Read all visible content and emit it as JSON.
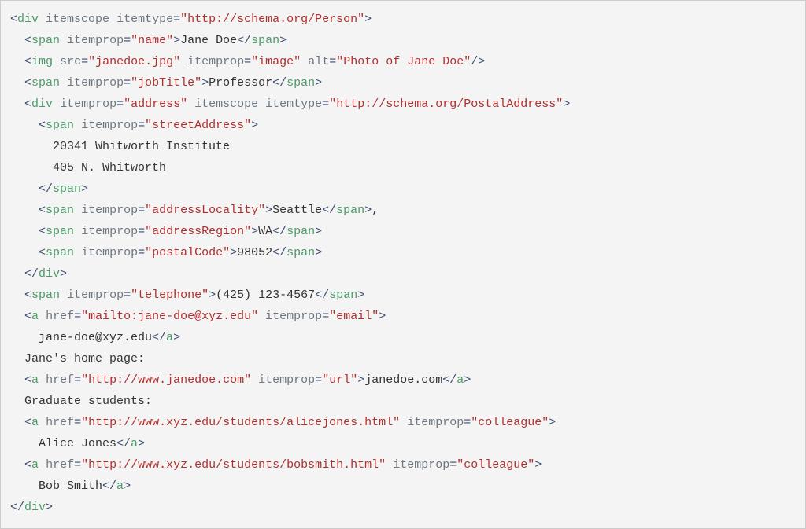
{
  "code": {
    "lines": [
      [
        [
          "p",
          "<"
        ],
        [
          "tg",
          "div"
        ],
        [
          "tx",
          " "
        ],
        [
          "at",
          "itemscope"
        ],
        [
          "tx",
          " "
        ],
        [
          "at",
          "itemtype"
        ],
        [
          "eq",
          "="
        ],
        [
          "st",
          "\"http://schema.org/Person\""
        ],
        [
          "p",
          ">"
        ]
      ],
      [
        [
          "tx",
          "  "
        ],
        [
          "p",
          "<"
        ],
        [
          "tg",
          "span"
        ],
        [
          "tx",
          " "
        ],
        [
          "at",
          "itemprop"
        ],
        [
          "eq",
          "="
        ],
        [
          "st",
          "\"name\""
        ],
        [
          "p",
          ">"
        ],
        [
          "tx",
          "Jane Doe"
        ],
        [
          "p",
          "</"
        ],
        [
          "tg",
          "span"
        ],
        [
          "p",
          ">"
        ]
      ],
      [
        [
          "tx",
          "  "
        ],
        [
          "p",
          "<"
        ],
        [
          "tg",
          "img"
        ],
        [
          "tx",
          " "
        ],
        [
          "at",
          "src"
        ],
        [
          "eq",
          "="
        ],
        [
          "st",
          "\"janedoe.jpg\""
        ],
        [
          "tx",
          " "
        ],
        [
          "at",
          "itemprop"
        ],
        [
          "eq",
          "="
        ],
        [
          "st",
          "\"image\""
        ],
        [
          "tx",
          " "
        ],
        [
          "at",
          "alt"
        ],
        [
          "eq",
          "="
        ],
        [
          "st",
          "\"Photo of Jane Doe\""
        ],
        [
          "p",
          "/>"
        ]
      ],
      [
        [
          "tx",
          "  "
        ],
        [
          "p",
          "<"
        ],
        [
          "tg",
          "span"
        ],
        [
          "tx",
          " "
        ],
        [
          "at",
          "itemprop"
        ],
        [
          "eq",
          "="
        ],
        [
          "st",
          "\"jobTitle\""
        ],
        [
          "p",
          ">"
        ],
        [
          "tx",
          "Professor"
        ],
        [
          "p",
          "</"
        ],
        [
          "tg",
          "span"
        ],
        [
          "p",
          ">"
        ]
      ],
      [
        [
          "tx",
          "  "
        ],
        [
          "p",
          "<"
        ],
        [
          "tg",
          "div"
        ],
        [
          "tx",
          " "
        ],
        [
          "at",
          "itemprop"
        ],
        [
          "eq",
          "="
        ],
        [
          "st",
          "\"address\""
        ],
        [
          "tx",
          " "
        ],
        [
          "at",
          "itemscope"
        ],
        [
          "tx",
          " "
        ],
        [
          "at",
          "itemtype"
        ],
        [
          "eq",
          "="
        ],
        [
          "st",
          "\"http://schema.org/PostalAddress\""
        ],
        [
          "p",
          ">"
        ]
      ],
      [
        [
          "tx",
          "    "
        ],
        [
          "p",
          "<"
        ],
        [
          "tg",
          "span"
        ],
        [
          "tx",
          " "
        ],
        [
          "at",
          "itemprop"
        ],
        [
          "eq",
          "="
        ],
        [
          "st",
          "\"streetAddress\""
        ],
        [
          "p",
          ">"
        ]
      ],
      [
        [
          "tx",
          "      20341 Whitworth Institute"
        ]
      ],
      [
        [
          "tx",
          "      405 N. Whitworth"
        ]
      ],
      [
        [
          "tx",
          "    "
        ],
        [
          "p",
          "</"
        ],
        [
          "tg",
          "span"
        ],
        [
          "p",
          ">"
        ]
      ],
      [
        [
          "tx",
          "    "
        ],
        [
          "p",
          "<"
        ],
        [
          "tg",
          "span"
        ],
        [
          "tx",
          " "
        ],
        [
          "at",
          "itemprop"
        ],
        [
          "eq",
          "="
        ],
        [
          "st",
          "\"addressLocality\""
        ],
        [
          "p",
          ">"
        ],
        [
          "tx",
          "Seattle"
        ],
        [
          "p",
          "</"
        ],
        [
          "tg",
          "span"
        ],
        [
          "p",
          ">"
        ],
        [
          "tx",
          ","
        ]
      ],
      [
        [
          "tx",
          "    "
        ],
        [
          "p",
          "<"
        ],
        [
          "tg",
          "span"
        ],
        [
          "tx",
          " "
        ],
        [
          "at",
          "itemprop"
        ],
        [
          "eq",
          "="
        ],
        [
          "st",
          "\"addressRegion\""
        ],
        [
          "p",
          ">"
        ],
        [
          "tx",
          "WA"
        ],
        [
          "p",
          "</"
        ],
        [
          "tg",
          "span"
        ],
        [
          "p",
          ">"
        ]
      ],
      [
        [
          "tx",
          "    "
        ],
        [
          "p",
          "<"
        ],
        [
          "tg",
          "span"
        ],
        [
          "tx",
          " "
        ],
        [
          "at",
          "itemprop"
        ],
        [
          "eq",
          "="
        ],
        [
          "st",
          "\"postalCode\""
        ],
        [
          "p",
          ">"
        ],
        [
          "tx",
          "98052"
        ],
        [
          "p",
          "</"
        ],
        [
          "tg",
          "span"
        ],
        [
          "p",
          ">"
        ]
      ],
      [
        [
          "tx",
          "  "
        ],
        [
          "p",
          "</"
        ],
        [
          "tg",
          "div"
        ],
        [
          "p",
          ">"
        ]
      ],
      [
        [
          "tx",
          "  "
        ],
        [
          "p",
          "<"
        ],
        [
          "tg",
          "span"
        ],
        [
          "tx",
          " "
        ],
        [
          "at",
          "itemprop"
        ],
        [
          "eq",
          "="
        ],
        [
          "st",
          "\"telephone\""
        ],
        [
          "p",
          ">"
        ],
        [
          "tx",
          "(425) 123-4567"
        ],
        [
          "p",
          "</"
        ],
        [
          "tg",
          "span"
        ],
        [
          "p",
          ">"
        ]
      ],
      [
        [
          "tx",
          "  "
        ],
        [
          "p",
          "<"
        ],
        [
          "tg",
          "a"
        ],
        [
          "tx",
          " "
        ],
        [
          "at",
          "href"
        ],
        [
          "eq",
          "="
        ],
        [
          "st",
          "\"mailto:jane-doe@xyz.edu\""
        ],
        [
          "tx",
          " "
        ],
        [
          "at",
          "itemprop"
        ],
        [
          "eq",
          "="
        ],
        [
          "st",
          "\"email\""
        ],
        [
          "p",
          ">"
        ]
      ],
      [
        [
          "tx",
          "    jane-doe@xyz.edu"
        ],
        [
          "p",
          "</"
        ],
        [
          "tg",
          "a"
        ],
        [
          "p",
          ">"
        ]
      ],
      [
        [
          "tx",
          "  Jane's home page:"
        ]
      ],
      [
        [
          "tx",
          "  "
        ],
        [
          "p",
          "<"
        ],
        [
          "tg",
          "a"
        ],
        [
          "tx",
          " "
        ],
        [
          "at",
          "href"
        ],
        [
          "eq",
          "="
        ],
        [
          "st",
          "\"http://www.janedoe.com\""
        ],
        [
          "tx",
          " "
        ],
        [
          "at",
          "itemprop"
        ],
        [
          "eq",
          "="
        ],
        [
          "st",
          "\"url\""
        ],
        [
          "p",
          ">"
        ],
        [
          "tx",
          "janedoe.com"
        ],
        [
          "p",
          "</"
        ],
        [
          "tg",
          "a"
        ],
        [
          "p",
          ">"
        ]
      ],
      [
        [
          "tx",
          "  Graduate students:"
        ]
      ],
      [
        [
          "tx",
          "  "
        ],
        [
          "p",
          "<"
        ],
        [
          "tg",
          "a"
        ],
        [
          "tx",
          " "
        ],
        [
          "at",
          "href"
        ],
        [
          "eq",
          "="
        ],
        [
          "st",
          "\"http://www.xyz.edu/students/alicejones.html\""
        ],
        [
          "tx",
          " "
        ],
        [
          "at",
          "itemprop"
        ],
        [
          "eq",
          "="
        ],
        [
          "st",
          "\"colleague\""
        ],
        [
          "p",
          ">"
        ]
      ],
      [
        [
          "tx",
          "    Alice Jones"
        ],
        [
          "p",
          "</"
        ],
        [
          "tg",
          "a"
        ],
        [
          "p",
          ">"
        ]
      ],
      [
        [
          "tx",
          "  "
        ],
        [
          "p",
          "<"
        ],
        [
          "tg",
          "a"
        ],
        [
          "tx",
          " "
        ],
        [
          "at",
          "href"
        ],
        [
          "eq",
          "="
        ],
        [
          "st",
          "\"http://www.xyz.edu/students/bobsmith.html\""
        ],
        [
          "tx",
          " "
        ],
        [
          "at",
          "itemprop"
        ],
        [
          "eq",
          "="
        ],
        [
          "st",
          "\"colleague\""
        ],
        [
          "p",
          ">"
        ]
      ],
      [
        [
          "tx",
          "    Bob Smith"
        ],
        [
          "p",
          "</"
        ],
        [
          "tg",
          "a"
        ],
        [
          "p",
          ">"
        ]
      ],
      [
        [
          "p",
          "</"
        ],
        [
          "tg",
          "div"
        ],
        [
          "p",
          ">"
        ]
      ]
    ]
  }
}
